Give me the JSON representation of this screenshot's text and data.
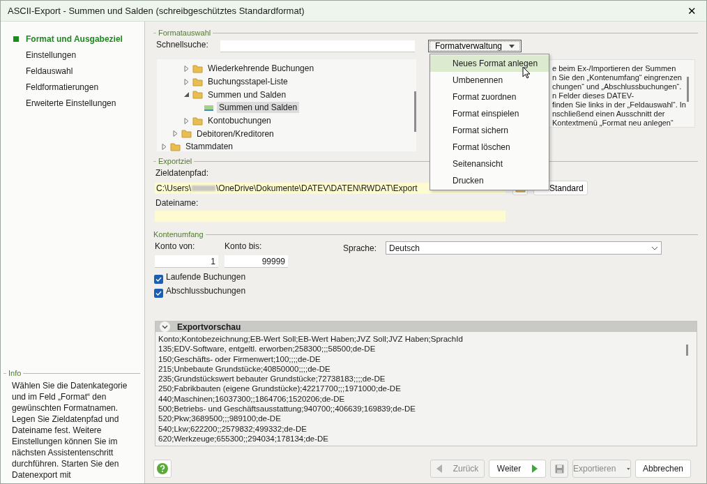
{
  "window": {
    "title": "ASCII-Export - Summen und Salden (schreibgeschütztes Standardformat)",
    "close": "✕"
  },
  "steps": [
    {
      "label": "Format und Ausgabeziel",
      "selected": true
    },
    {
      "label": "Einstellungen",
      "selected": false
    },
    {
      "label": "Feldauswahl",
      "selected": false
    },
    {
      "label": "Feldformatierungen",
      "selected": false
    },
    {
      "label": "Erweiterte Einstellungen",
      "selected": false
    }
  ],
  "info": {
    "legend": "Info",
    "text": "Wählen Sie die Datenkategorie und im Feld „Format“ den gewünschten Formatnamen. Legen Sie Zieldatenpfad und Dateiname fest. Weitere Einstellungen können Sie im nächsten Assistentenschritt durchführen. Starten Sie den Datenexport mit"
  },
  "formatauswahl": {
    "legend": "Formatauswahl",
    "search_label": "Schnellsuche:",
    "format_button": "Formatverwaltung",
    "tree": [
      {
        "children": [
          {
            "children": [
              {
                "label": "Wiederkehrende Buchungen",
                "kind": "folder",
                "expanded": false,
                "selected": false
              },
              {
                "label": "Buchungsstapel-Liste",
                "kind": "folder",
                "expanded": false,
                "selected": false
              },
              {
                "label": "Summen und Salden",
                "kind": "folder",
                "expanded": true,
                "selected": false,
                "children": [
                  {
                    "label": "Summen und Salden",
                    "kind": "format",
                    "selected": true
                  }
                ]
              },
              {
                "label": "Kontobuchungen",
                "kind": "folder",
                "expanded": false,
                "selected": false
              }
            ]
          },
          {
            "label": "Debitoren/Kreditoren",
            "kind": "folder",
            "expanded": false,
            "selected": false
          }
        ]
      },
      {
        "label": "Stammdaten",
        "kind": "folder",
        "expanded": false,
        "selected": false
      }
    ],
    "description": [
      "e beim Ex-/Importieren der Summen",
      "n Sie den „Kontenumfang“ eingrenzen",
      "chungen“ und „Abschlussbuchungen“.",
      "n Felder dieses DATEV-",
      "finden Sie links in der „Feldauswahl“. In",
      "nschließend einen Ausschnitt der",
      "Kontextmenü „Format neu anlegen“"
    ]
  },
  "menu": [
    {
      "label": "Neues Format anlegen",
      "selected": true
    },
    {
      "label": "Umbenennen",
      "selected": false
    },
    {
      "label": "Format zuordnen",
      "selected": false
    },
    {
      "label": "Format einspielen",
      "selected": false
    },
    {
      "label": "Format sichern",
      "selected": false
    },
    {
      "label": "Format löschen",
      "selected": false
    },
    {
      "label": "Seitenansicht",
      "selected": false
    },
    {
      "label": "Drucken",
      "selected": false
    }
  ],
  "exportziel": {
    "legend": "Exportziel",
    "path_label": "Zieldatenpfad:",
    "path_start": "C:\\Users\\",
    "path_end": "\\OneDrive\\Dokumente\\DATEV\\DATEN\\RWDAT\\Export",
    "standard_button": "Standard",
    "file_label": "Dateiname:"
  },
  "kontenumfang": {
    "legend": "Kontenumfang",
    "from_label": "Konto von:",
    "from_value": "1",
    "to_label": "Konto bis:",
    "to_value": "99999",
    "language_label": "Sprache:",
    "language_value": "Deutsch",
    "options": [
      {
        "label": "Laufende Buchungen",
        "checked": true
      },
      {
        "label": "Abschlussbuchungen",
        "checked": true
      }
    ]
  },
  "preview": {
    "title": "Exportvorschau",
    "expanded": true,
    "lines": [
      "Konto;Kontobezeichnung;EB-Wert Soll;EB-Wert Haben;JVZ Soll;JVZ Haben;SprachId",
      "135;EDV-Software, entgeltl. erworben;258300;;;58500;de-DE",
      "150;Geschäfts- oder Firmenwert;100;;;;de-DE",
      "215;Unbebaute Grundstücke;40850000;;;;de-DE",
      "235;Grundstückswert bebauter Grundstücke;72738183;;;;de-DE",
      "250;Fabrikbauten (eigene Grundstücke);42217700;;;1971000;de-DE",
      "440;Maschinen;16037300;;1864706;1520206;de-DE",
      "500;Betriebs- und Geschäftsausstattung;940700;;406639;169839;de-DE",
      "520;Pkw;3689500;;;989100;de-DE",
      "540;Lkw;622200;;2579832;499332;de-DE",
      "620;Werkzeuge;655300;;294034;178134;de-DE"
    ]
  },
  "buttons": [
    {
      "label": "Zurück",
      "kind": "back",
      "disabled": true
    },
    {
      "label": "Weiter",
      "kind": "next",
      "disabled": false
    },
    {
      "kind": "save",
      "disabled": true
    },
    {
      "label": "Exportieren",
      "kind": "export",
      "disabled": true
    },
    {
      "label": "Abbrechen",
      "kind": "cancel",
      "disabled": false
    }
  ]
}
